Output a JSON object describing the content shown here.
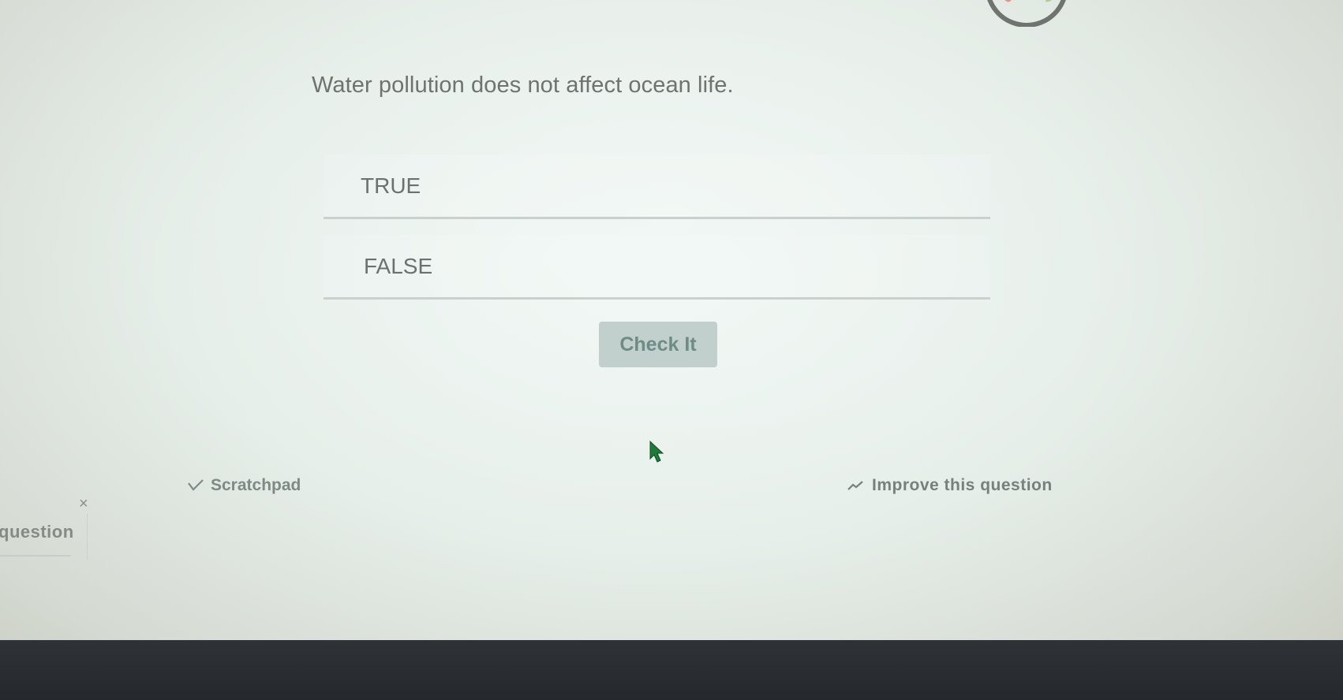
{
  "question": {
    "text": "Water pollution does not affect ocean life."
  },
  "choices": [
    {
      "label": "TRUE"
    },
    {
      "label": "FALSE"
    }
  ],
  "actions": {
    "check_label": "Check It"
  },
  "footer": {
    "scratchpad_label": "Scratchpad",
    "scratchpad_icon": "pencil-icon",
    "improve_label": "Improve this question",
    "improve_icon": "trend-icon"
  },
  "side_panel": {
    "label": "question",
    "close_symbol": "×"
  },
  "colors": {
    "accent_button": "#c2d0cd",
    "button_text": "#6e8b86",
    "taskbar": "#2a2d32"
  }
}
